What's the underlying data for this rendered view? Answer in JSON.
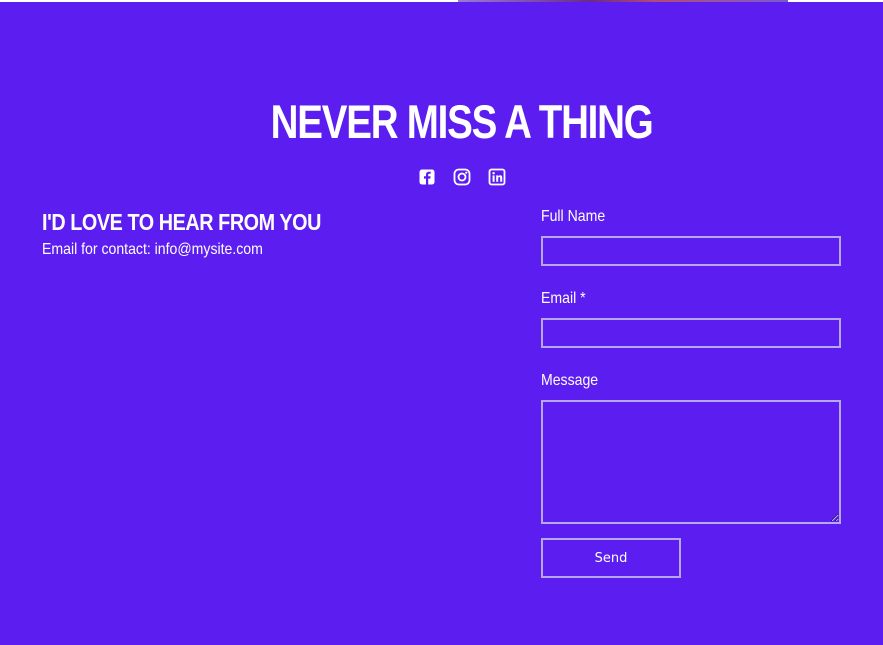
{
  "colors": {
    "background": "#5c1ef0",
    "text": "#ffffff",
    "field_border": "#b9a7ee"
  },
  "hero": {
    "title": "NEVER MISS A THING"
  },
  "social": {
    "icons": [
      "facebook-icon",
      "instagram-icon",
      "linkedin-icon"
    ]
  },
  "contact": {
    "heading": "I'D LOVE TO HEAR FROM YOU",
    "email_prefix": "Email for contact: ",
    "email_address": "info@mysite.com"
  },
  "form": {
    "full_name_label": "Full Name",
    "full_name_value": "",
    "email_label": "Email *",
    "email_value": "",
    "message_label": "Message",
    "message_value": "",
    "send_label": "Send"
  }
}
